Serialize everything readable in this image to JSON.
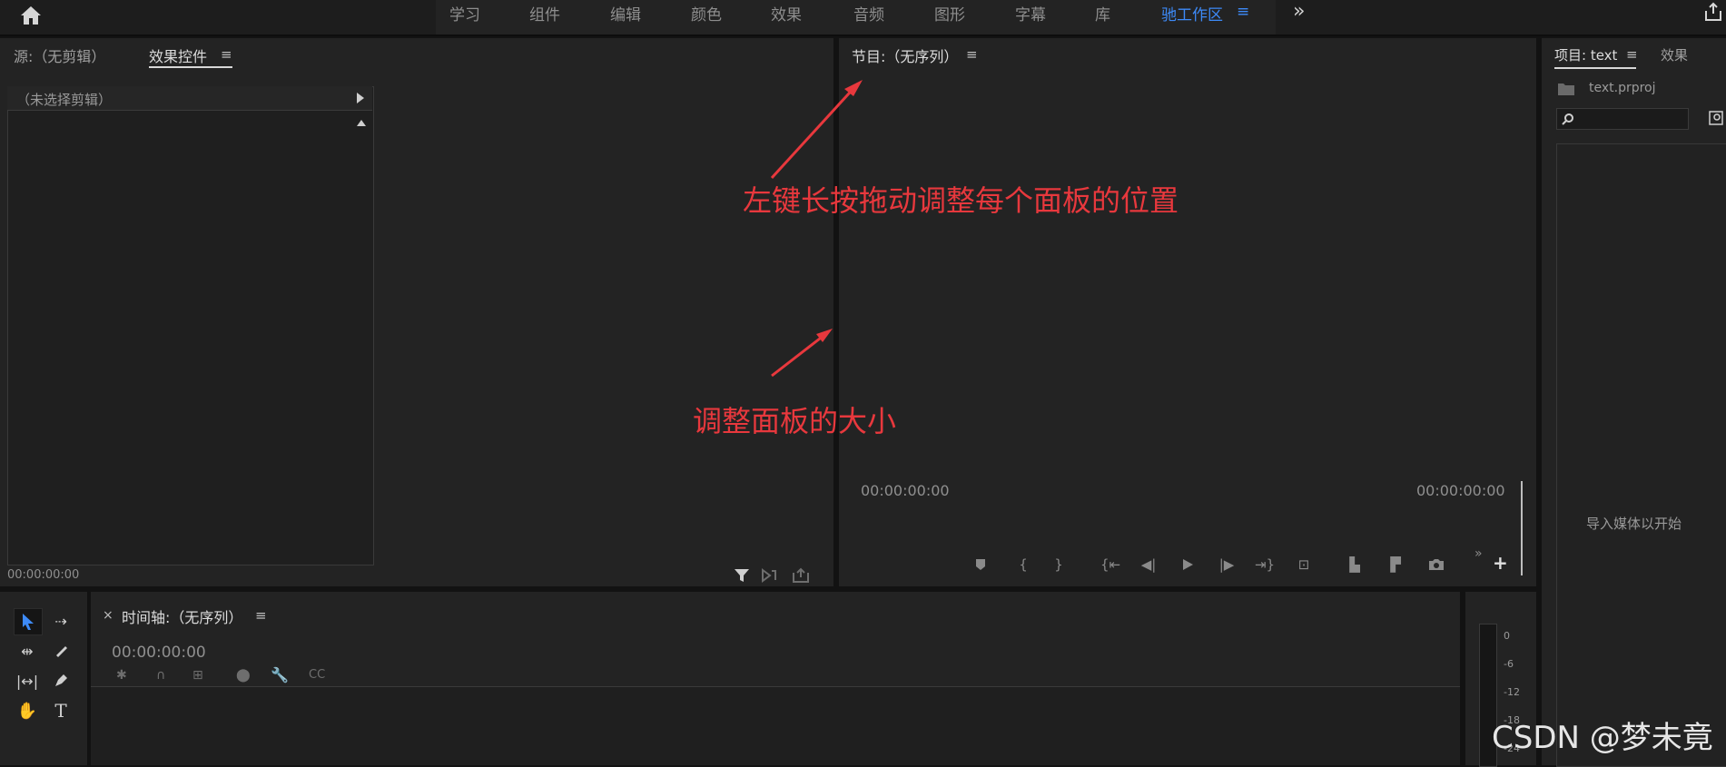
{
  "topbar": {
    "workspaces": [
      "学习",
      "组件",
      "编辑",
      "颜色",
      "效果",
      "音频",
      "图形",
      "字幕",
      "库",
      "驰工作区"
    ],
    "active_workspace": "驰工作区",
    "menu_glyph": "≡",
    "more_glyph": "»"
  },
  "source_panel": {
    "tab_source": "源:（无剪辑）",
    "tab_effect_controls": "效果控件",
    "menu_glyph": "≡",
    "clip_header": "（未选择剪辑）",
    "timecode": "00:00:00:00"
  },
  "program_panel": {
    "title": "节目:（无序列）",
    "menu_glyph": "≡",
    "timecode_left": "00:00:00:00",
    "timecode_right": "00:00:00:00"
  },
  "project_panel": {
    "tab_project": "项目: text",
    "tab_effects": "效果",
    "menu_glyph": "≡",
    "file_name": "text.prproj",
    "empty_message": "导入媒体以开始"
  },
  "timeline_panel": {
    "close_glyph": "×",
    "title": "时间轴:（无序列）",
    "menu_glyph": "≡",
    "timecode": "00:00:00:00"
  },
  "meter": {
    "ticks": [
      "0",
      "-6",
      "-12",
      "-18",
      "-24"
    ]
  },
  "annotations": {
    "drag_hint": "左键长按拖动调整每个面板的位置",
    "resize_hint": "调整面板的大小",
    "color": "#e8383d"
  },
  "watermark": "CSDN @梦未竟"
}
